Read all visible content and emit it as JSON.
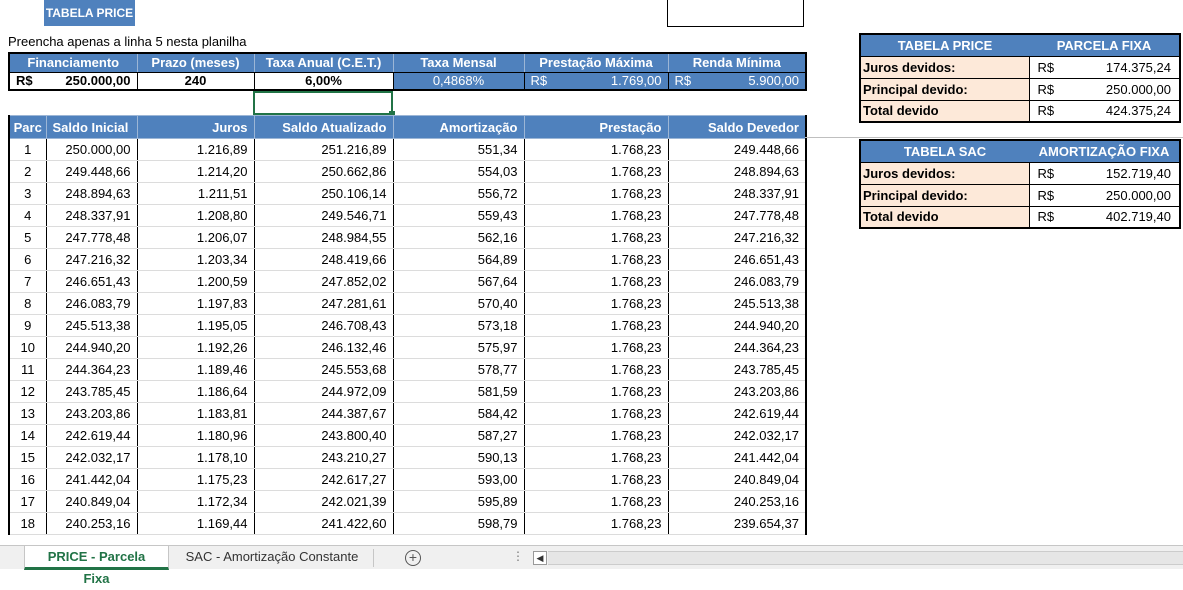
{
  "sheet_title": "TABELA PRICE",
  "instruction": "Preencha apenas a linha 5 nesta planilha",
  "summary": {
    "headers": [
      "Financiamento",
      "Prazo (meses)",
      "Taxa Anual (C.E.T.)",
      "Taxa Mensal",
      "Prestação Máxima",
      "Renda Mínima"
    ],
    "currency": "R$",
    "financiamento": "250.000,00",
    "prazo": "240",
    "taxa_anual": "6,00%",
    "taxa_mensal": "0,4868%",
    "prestacao_maxima": "1.769,00",
    "renda_minima": "5.900,00"
  },
  "amortization": {
    "headers": [
      "Parc",
      "Saldo Inicial",
      "Juros",
      "Saldo Atualizado",
      "Amortização",
      "Prestação",
      "Saldo Devedor"
    ],
    "rows": [
      [
        "1",
        "250.000,00",
        "1.216,89",
        "251.216,89",
        "551,34",
        "1.768,23",
        "249.448,66"
      ],
      [
        "2",
        "249.448,66",
        "1.214,20",
        "250.662,86",
        "554,03",
        "1.768,23",
        "248.894,63"
      ],
      [
        "3",
        "248.894,63",
        "1.211,51",
        "250.106,14",
        "556,72",
        "1.768,23",
        "248.337,91"
      ],
      [
        "4",
        "248.337,91",
        "1.208,80",
        "249.546,71",
        "559,43",
        "1.768,23",
        "247.778,48"
      ],
      [
        "5",
        "247.778,48",
        "1.206,07",
        "248.984,55",
        "562,16",
        "1.768,23",
        "247.216,32"
      ],
      [
        "6",
        "247.216,32",
        "1.203,34",
        "248.419,66",
        "564,89",
        "1.768,23",
        "246.651,43"
      ],
      [
        "7",
        "246.651,43",
        "1.200,59",
        "247.852,02",
        "567,64",
        "1.768,23",
        "246.083,79"
      ],
      [
        "8",
        "246.083,79",
        "1.197,83",
        "247.281,61",
        "570,40",
        "1.768,23",
        "245.513,38"
      ],
      [
        "9",
        "245.513,38",
        "1.195,05",
        "246.708,43",
        "573,18",
        "1.768,23",
        "244.940,20"
      ],
      [
        "10",
        "244.940,20",
        "1.192,26",
        "246.132,46",
        "575,97",
        "1.768,23",
        "244.364,23"
      ],
      [
        "11",
        "244.364,23",
        "1.189,46",
        "245.553,68",
        "578,77",
        "1.768,23",
        "243.785,45"
      ],
      [
        "12",
        "243.785,45",
        "1.186,64",
        "244.972,09",
        "581,59",
        "1.768,23",
        "243.203,86"
      ],
      [
        "13",
        "243.203,86",
        "1.183,81",
        "244.387,67",
        "584,42",
        "1.768,23",
        "242.619,44"
      ],
      [
        "14",
        "242.619,44",
        "1.180,96",
        "243.800,40",
        "587,27",
        "1.768,23",
        "242.032,17"
      ],
      [
        "15",
        "242.032,17",
        "1.178,10",
        "243.210,27",
        "590,13",
        "1.768,23",
        "241.442,04"
      ],
      [
        "16",
        "241.442,04",
        "1.175,23",
        "242.617,27",
        "593,00",
        "1.768,23",
        "240.849,04"
      ],
      [
        "17",
        "240.849,04",
        "1.172,34",
        "242.021,39",
        "595,89",
        "1.768,23",
        "240.253,16"
      ],
      [
        "18",
        "240.253,16",
        "1.169,44",
        "241.422,60",
        "598,79",
        "1.768,23",
        "239.654,37"
      ]
    ]
  },
  "price_summary": {
    "title": "TABELA PRICE",
    "subtitle": "PARCELA FIXA",
    "currency": "R$",
    "rows": [
      {
        "label": "Juros devidos:",
        "value": "174.375,24"
      },
      {
        "label": "Principal devido:",
        "value": "250.000,00"
      },
      {
        "label": "Total devido",
        "value": "424.375,24"
      }
    ]
  },
  "sac_summary": {
    "title": "TABELA SAC",
    "subtitle": "AMORTIZAÇÃO FIXA",
    "currency": "R$",
    "rows": [
      {
        "label": "Juros devidos:",
        "value": "152.719,40"
      },
      {
        "label": "Principal devido:",
        "value": "250.000,00"
      },
      {
        "label": "Total devido",
        "value": "402.719,40"
      }
    ]
  },
  "sheet_tabs": {
    "active": "PRICE - Parcela Fixa",
    "inactive": "SAC - Amortização Constante",
    "add_symbol": "+",
    "scroll_dots": "⋮",
    "scroll_left": "◀"
  },
  "colors": {
    "header_blue": "#4f81bd",
    "label_peach": "#fde9d9",
    "excel_green": "#217346"
  }
}
